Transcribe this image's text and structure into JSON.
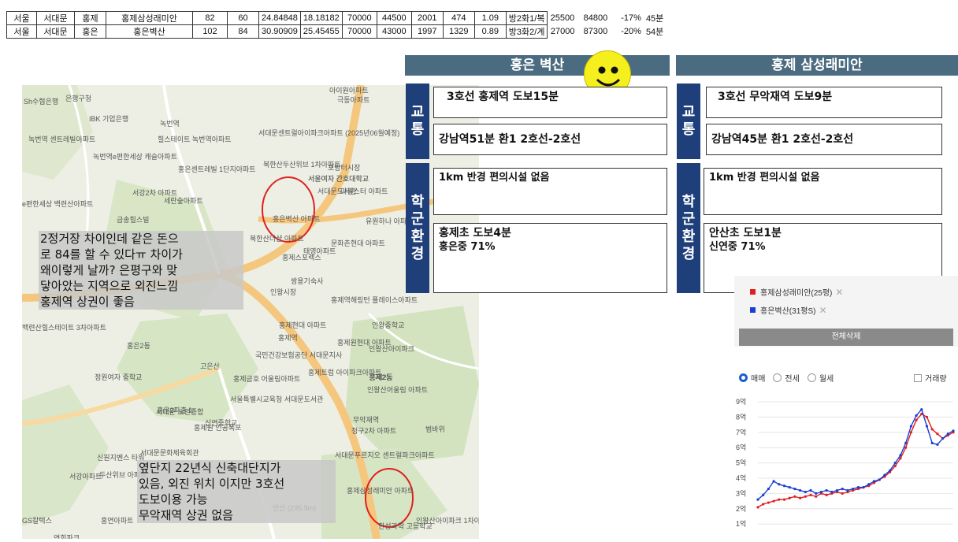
{
  "table_rows": [
    [
      "서울",
      "서대문",
      "홍제",
      "홍제삼성래미안",
      "82",
      "60",
      "24.84848",
      "18.18182",
      "70000",
      "44500",
      "2001",
      "474",
      "1.09",
      "방2화1/복",
      "25500",
      "84800",
      "-17%",
      "45분"
    ],
    [
      "서울",
      "서대문",
      "홍은",
      "홍은벽산",
      "102",
      "84",
      "30.90909",
      "25.45455",
      "70000",
      "43000",
      "1997",
      "1329",
      "0.89",
      "방3화2/계",
      "27000",
      "87300",
      "-20%",
      "54분"
    ]
  ],
  "map": {
    "labels": [
      "아이원아파트",
      "Sh수협은행",
      "은평구청",
      "극동아파트",
      "IBK 기업은행",
      "녹번역",
      "녹번역 센트레빌아파트",
      "힐스테이트 녹번역아파트",
      "서대문센트럴아이파크아파트 (2025년06월예정)",
      "녹번역e편한세상 캐슬아파트",
      "홍은센트레빌 1단지아파트",
      "북한산두산위브 1차아파트",
      "포방터시장",
      "서울여자 간호대학교",
      "서대문도서관",
      "서강2차 아파트",
      "세란숲아파트",
      "e편한세상 백련산아파트",
      "금송힐스빌",
      "홍은벽산 아파트",
      "마젤스터 아파트",
      "유원하나 아파트",
      "북한산더샵 아파트",
      "문화촌현대 아파트",
      "홍제스포렉스",
      "태영아파트",
      "쌍용기숙사",
      "인왕시장",
      "홍제역해링턴 플레이스아파트",
      "홍제역",
      "홍제현대 아파트",
      "홍은2동",
      "국민건강보험공단 서대문지사",
      "홍제원현대 아파트",
      "인왕산아이파크",
      "고은산",
      "홍제금호 어울림아파트",
      "홍제트럼 아이파크아파트",
      "홍제2동",
      "인왕산어울림 아파트",
      "정원여자 중학교",
      "서울특별시교육청 서대문도서관",
      "홍은2파출소",
      "신연중학교",
      "서대문 노인종합",
      "무악재역",
      "청구2차 아파트",
      "홍제원 인공폭포",
      "신원지벤스 타워",
      "서대문문화체육회관",
      "서대문푸르지오 센트럴파크아파트",
      "두산위브 아파트",
      "서강아파트",
      "GS칼텍스",
      "홍연아파트",
      "홍제삼성래미안 아파트",
      "안산 (295.9m)",
      "인왕산아이파크 1차아파트",
      "한성과학 고등학교",
      "범바위",
      "인왕중학교",
      "백련산힐스테이트 3차아파트",
      "홍제2동",
      "서울여자 간호대학교",
      "연희파크"
    ],
    "note1": [
      "2정거장 차이인데 같은 돈으",
      "로 84를 할 수 있다ㅠ 차이가",
      "왜이렇게 날까? 은평구와 맞",
      "닿아았는 지역으로 외진느낌",
      "홍제역 상권이 좋음"
    ],
    "note2": [
      "옆단지 22년식 신축대단지가",
      "있음, 외진 위치 이지만 3호선",
      "도보이용 가능",
      "무악재역 상권 없음"
    ]
  },
  "compare": {
    "left_title": "홍은 벽산",
    "right_title": "홍제 삼성래미안",
    "tag_traffic": [
      "교",
      "통"
    ],
    "tag_school": [
      "학",
      "군",
      "환",
      "경"
    ],
    "left": {
      "transit": "3호선 홍제역 도보15분",
      "commute": "강남역51분 환1 2호선-2호선",
      "conv": "1km 반경 편의시설 없음",
      "school": [
        "홍제초 도보4분",
        "홍은중 71%"
      ]
    },
    "right": {
      "transit": "3호선 무악재역 도보9분",
      "commute": "강남역45분 환1 2호선-2호선",
      "conv": "1km 반경 편의시설 없음",
      "school": [
        "안산초 도보1분",
        "신연중 71%"
      ]
    }
  },
  "widget": {
    "legend": [
      {
        "label": "홍제삼성래미안(25평)",
        "color": "#e02020"
      },
      {
        "label": "홍은벽산(31평S)",
        "color": "#1a3fd1"
      }
    ],
    "delete_all": "전체삭제",
    "radios": [
      "매매",
      "전세",
      "월세"
    ],
    "radio_selected": "매매",
    "checkbox_label": "거래량",
    "colors": {
      "red": "#e02020",
      "blue": "#1a3fd1",
      "delete_bg": "#8a8a8a"
    }
  },
  "chart_data": {
    "type": "line",
    "y_tick_labels": [
      "9억",
      "8억",
      "7억",
      "6억",
      "5억",
      "4억",
      "3억",
      "2억",
      "1억"
    ],
    "ylim": [
      0,
      9
    ],
    "series": [
      {
        "name": "홍제삼성래미안(25평)",
        "color": "#e02020",
        "values": [
          2.1,
          2.3,
          2.4,
          2.5,
          2.6,
          2.6,
          2.7,
          2.8,
          2.7,
          2.8,
          2.9,
          2.8,
          3.0,
          2.9,
          3.0,
          3.1,
          3.0,
          3.1,
          3.2,
          3.3,
          3.4,
          3.5,
          3.7,
          3.9,
          4.1,
          4.4,
          4.8,
          5.3,
          6.0,
          7.0,
          7.8,
          8.2,
          8.0,
          7.2,
          6.9,
          6.6,
          6.8,
          7.0
        ]
      },
      {
        "name": "홍은벽산(31평S)",
        "color": "#1a3fd1",
        "values": [
          2.6,
          2.9,
          3.3,
          3.8,
          3.6,
          3.5,
          3.4,
          3.3,
          3.2,
          3.1,
          3.2,
          3.0,
          3.1,
          3.2,
          3.1,
          3.2,
          3.3,
          3.2,
          3.3,
          3.4,
          3.4,
          3.6,
          3.8,
          3.9,
          4.2,
          4.5,
          5.0,
          5.5,
          6.3,
          7.4,
          8.1,
          8.5,
          7.4,
          6.3,
          6.2,
          6.6,
          6.9,
          7.1
        ]
      }
    ]
  }
}
